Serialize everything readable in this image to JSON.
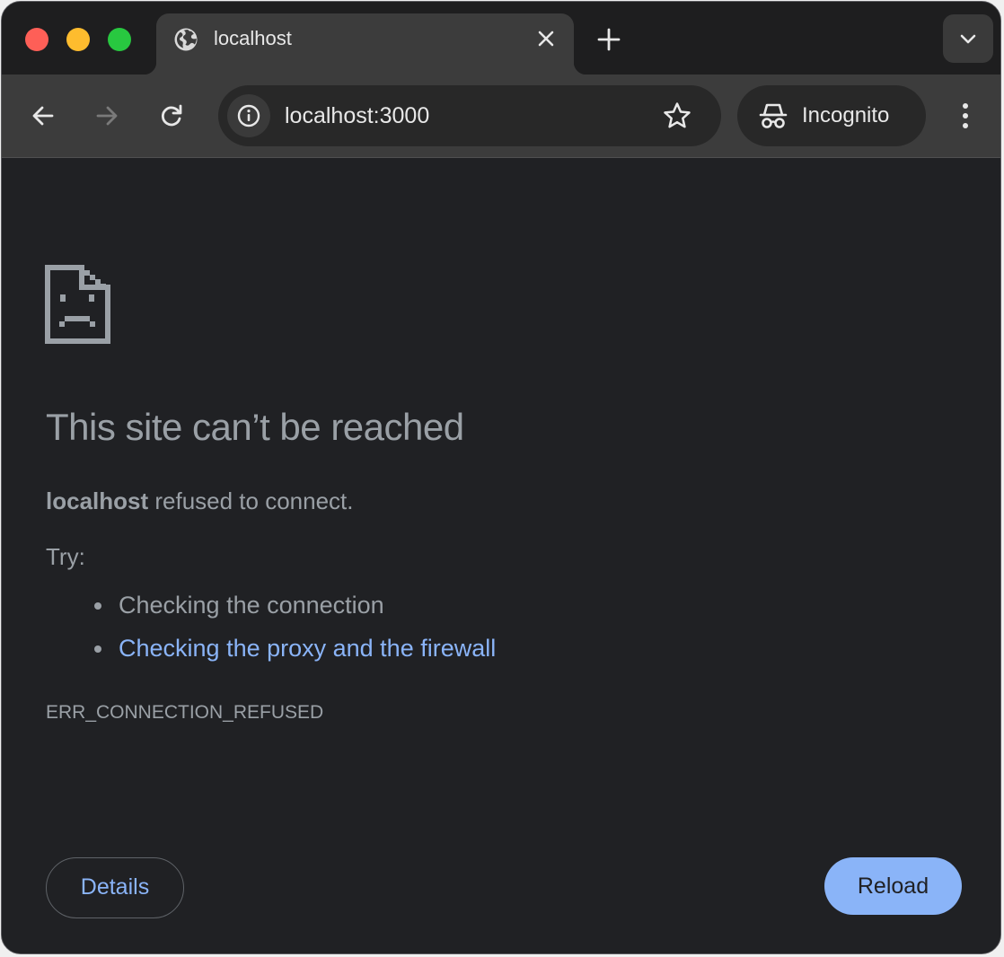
{
  "tab": {
    "title": "localhost",
    "favicon": "globe-icon"
  },
  "toolbar": {
    "url": "localhost:3000",
    "profile_label": "Incognito"
  },
  "error_page": {
    "heading": "This site can’t be reached",
    "host": "localhost",
    "summary_rest": " refused to connect.",
    "try_label": "Try:",
    "suggestions": [
      {
        "text": "Checking the connection",
        "is_link": false
      },
      {
        "text": "Checking the proxy and the firewall",
        "is_link": true
      }
    ],
    "error_code": "ERR_CONNECTION_REFUSED",
    "details_label": "Details",
    "reload_label": "Reload"
  },
  "colors": {
    "page_bg": "#202124",
    "text_secondary": "#9aa0a6",
    "link": "#8ab4f8",
    "reload_bg": "#8ab4f8",
    "toolbar_bg": "#3c3c3c",
    "tabstrip_bg": "#1e1e1f"
  }
}
